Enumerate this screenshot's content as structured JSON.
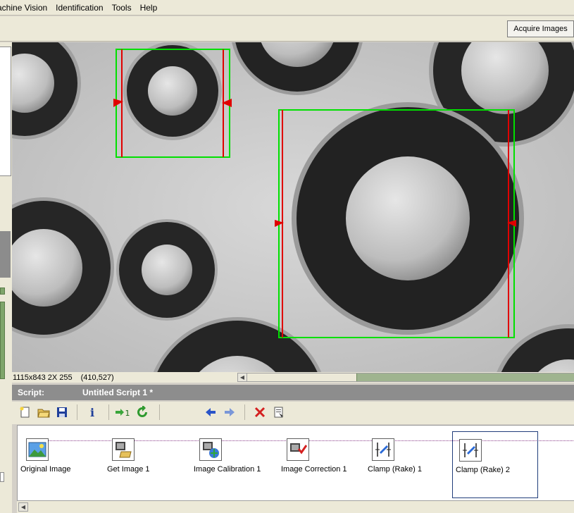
{
  "menu": {
    "items": [
      "achine Vision",
      "Identification",
      "Tools",
      "Help"
    ]
  },
  "toolbar": {
    "acquire_label": "Acquire Images"
  },
  "status": {
    "image_info": "1115x843 2X 255",
    "coordinates": "(410,527)"
  },
  "script": {
    "label": "Script:",
    "name": "Untitled Script 1 *"
  },
  "steps": [
    {
      "label": "Original Image",
      "icon": "original-image-icon"
    },
    {
      "label": "Get Image 1",
      "icon": "get-image-icon"
    },
    {
      "label": "Image Calibration 1",
      "icon": "image-calibration-icon"
    },
    {
      "label": "Image Correction 1",
      "icon": "image-correction-icon"
    },
    {
      "label": "Clamp (Rake) 1",
      "icon": "clamp-rake-icon"
    },
    {
      "label": "Clamp (Rake) 2",
      "icon": "clamp-rake-icon"
    }
  ],
  "colors": {
    "roi": "#00e000",
    "edge": "#e00000",
    "header": "#8d8d8d"
  }
}
